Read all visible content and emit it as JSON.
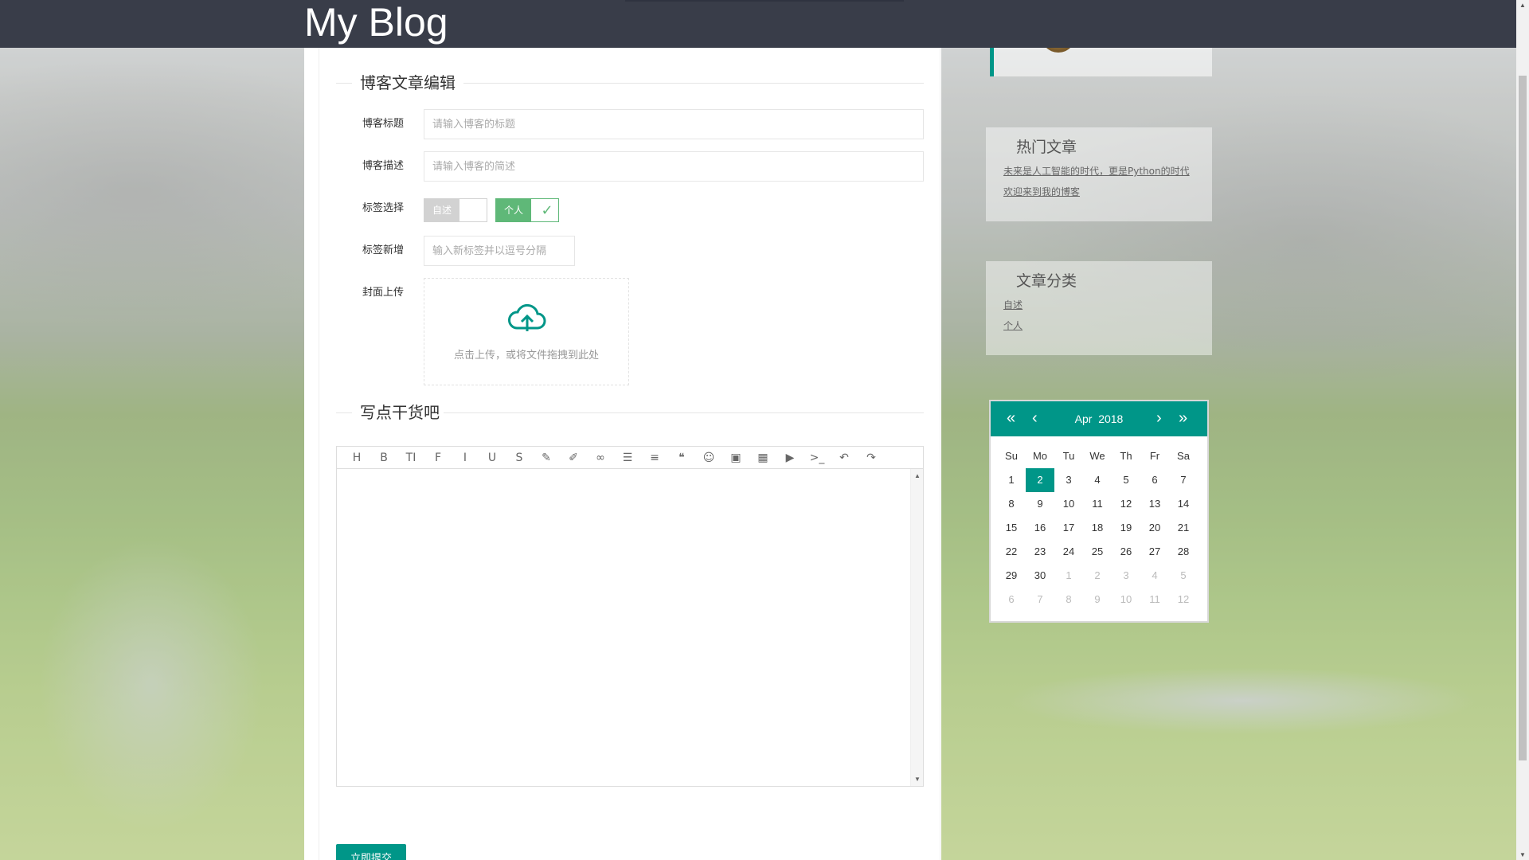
{
  "header": {
    "brand": "My Blog"
  },
  "form": {
    "section_title": "博客文章编辑",
    "title_label": "博客标题",
    "title_placeholder": "请输入博客的标题",
    "desc_label": "博客描述",
    "desc_placeholder": "请输入博客的简述",
    "tag_select_label": "标签选择",
    "tags": [
      {
        "label": "自述",
        "checked": false
      },
      {
        "label": "个人",
        "checked": true
      }
    ],
    "tag_new_label": "标签新增",
    "tag_new_placeholder": "输入新标签并以逗号分隔",
    "cover_label": "封面上传",
    "upload_text": "点击上传，或将文件拖拽到此处"
  },
  "editor": {
    "section_title": "写点干货吧",
    "toolbar": [
      {
        "icon": "heading-icon",
        "glyph": "H"
      },
      {
        "icon": "bold-icon",
        "glyph": "B"
      },
      {
        "icon": "text-size-icon",
        "glyph": "TI"
      },
      {
        "icon": "font-icon",
        "glyph": "F"
      },
      {
        "icon": "italic-icon",
        "glyph": "I"
      },
      {
        "icon": "underline-icon",
        "glyph": "U"
      },
      {
        "icon": "strikethrough-icon",
        "glyph": "S"
      },
      {
        "icon": "eraser-icon",
        "glyph": "✎"
      },
      {
        "icon": "brush-icon",
        "glyph": "✐"
      },
      {
        "icon": "link-icon",
        "glyph": "∞"
      },
      {
        "icon": "list-icon",
        "glyph": "☰"
      },
      {
        "icon": "align-icon",
        "glyph": "≡"
      },
      {
        "icon": "quote-icon",
        "glyph": "❝"
      },
      {
        "icon": "emoji-icon",
        "glyph": "☺"
      },
      {
        "icon": "image-icon",
        "glyph": "▣"
      },
      {
        "icon": "table-icon",
        "glyph": "▦"
      },
      {
        "icon": "video-icon",
        "glyph": "▶"
      },
      {
        "icon": "code-icon",
        "glyph": ">_"
      },
      {
        "icon": "undo-icon",
        "glyph": "↶"
      },
      {
        "icon": "redo-icon",
        "glyph": "↷"
      }
    ],
    "submit_label": "立即提交"
  },
  "sidebar": {
    "hot_title": "热门文章",
    "hot_articles": [
      "未来是人工智能的时代，更是Python的时代",
      "欢迎来到我的博客"
    ],
    "category_title": "文章分类",
    "categories": [
      "自述",
      "个人"
    ]
  },
  "calendar": {
    "month": "Apr",
    "year": "2018",
    "weekdays": [
      "Su",
      "Mo",
      "Tu",
      "We",
      "Th",
      "Fr",
      "Sa"
    ],
    "weeks": [
      [
        "1",
        "2",
        "3",
        "4",
        "5",
        "6",
        "7"
      ],
      [
        "8",
        "9",
        "10",
        "11",
        "12",
        "13",
        "14"
      ],
      [
        "15",
        "16",
        "17",
        "18",
        "19",
        "20",
        "21"
      ],
      [
        "22",
        "23",
        "24",
        "25",
        "26",
        "27",
        "28"
      ],
      [
        "29",
        "30",
        "1",
        "2",
        "3",
        "4",
        "5"
      ],
      [
        "6",
        "7",
        "8",
        "9",
        "10",
        "11",
        "12"
      ]
    ],
    "selected_day": "2",
    "accent_color": "#009688"
  }
}
